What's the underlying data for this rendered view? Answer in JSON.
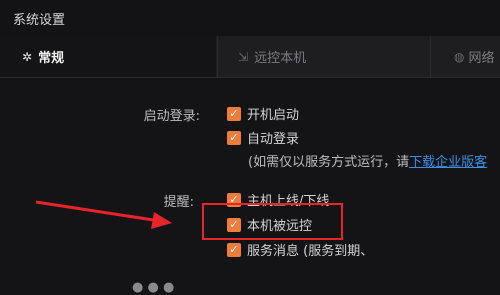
{
  "window": {
    "title": "系统设置"
  },
  "tabs": [
    {
      "label": "常规",
      "icon": "gear-icon",
      "active": true
    },
    {
      "label": "远控本机",
      "icon": "remote-control-icon",
      "active": false
    },
    {
      "label": "网络",
      "icon": "network-icon",
      "active": false
    }
  ],
  "startup": {
    "label": "启动登录:",
    "options": [
      {
        "label": "开机启动",
        "checked": true
      },
      {
        "label": "自动登录",
        "checked": true
      }
    ],
    "note_prefix": "(如需仅以服务方式运行，请",
    "note_link": "下载企业版客"
  },
  "reminder": {
    "label": "提醒:",
    "options": [
      {
        "label": "主机上线/下线",
        "checked": true
      },
      {
        "label": "本机被远控",
        "checked": true
      },
      {
        "label": "服务消息 (服务到期、",
        "checked": true
      }
    ]
  },
  "annotation": {
    "color": "#e8242b"
  },
  "colors": {
    "accent": "#ee7d3b",
    "link": "#3b8fe8",
    "background": "#141416"
  }
}
